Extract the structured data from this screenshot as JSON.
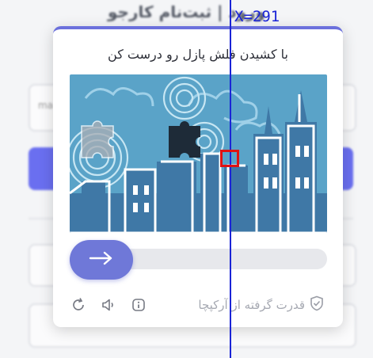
{
  "background_page": {
    "title": "ورود | ثبت‌نام کارجو",
    "field_hint": "ma"
  },
  "captcha": {
    "instruction": "با کشیدن فلش پازل رو درست کن",
    "credit": "قدرت گرفته از آرکپچا",
    "slider_progress": 0,
    "accent_color": "#6f78d8",
    "icons": [
      "arrow-right-icon",
      "shield-check-icon",
      "info-icon",
      "sound-icon",
      "refresh-icon"
    ]
  },
  "overlay": {
    "label": "X=291",
    "marker_color": "#e01212",
    "line_color": "#1a24d6"
  }
}
